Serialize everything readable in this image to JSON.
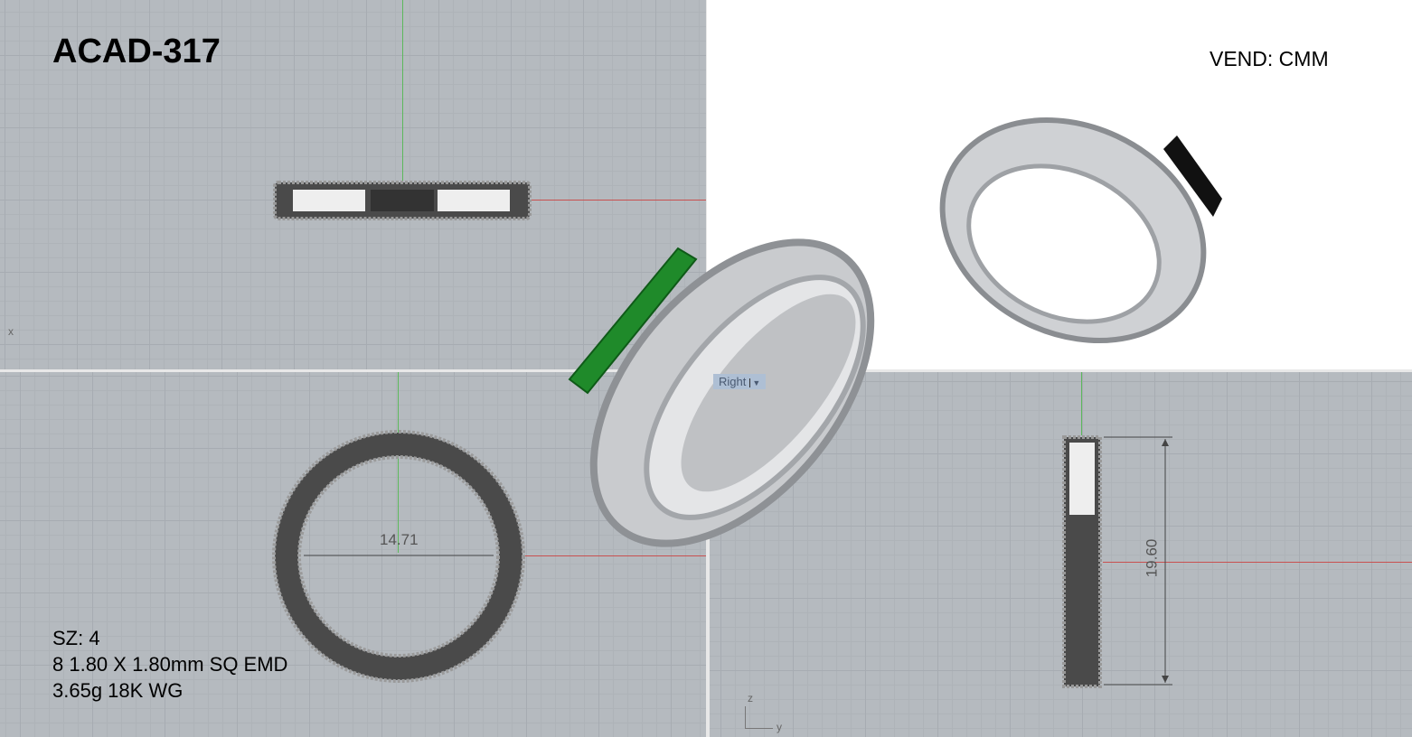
{
  "title": "ACAD-317",
  "vendor": "VEND: CMM",
  "specs": {
    "size": "SZ: 4",
    "stones": "8 1.80 X 1.80mm SQ EMD",
    "metal": "3.65g 18K WG"
  },
  "viewports": {
    "top": {
      "axis_label": "x"
    },
    "front": {
      "dimension": "14.71"
    },
    "right": {
      "label": "Right",
      "dimension": "19.60",
      "axis_z": "z",
      "axis_y": "y"
    }
  },
  "colors": {
    "grid": "#b5babf",
    "x_axis": "#c85050",
    "y_axis": "#4caf50",
    "emerald": "#1f8a2a",
    "metal": "#c9cbce"
  }
}
